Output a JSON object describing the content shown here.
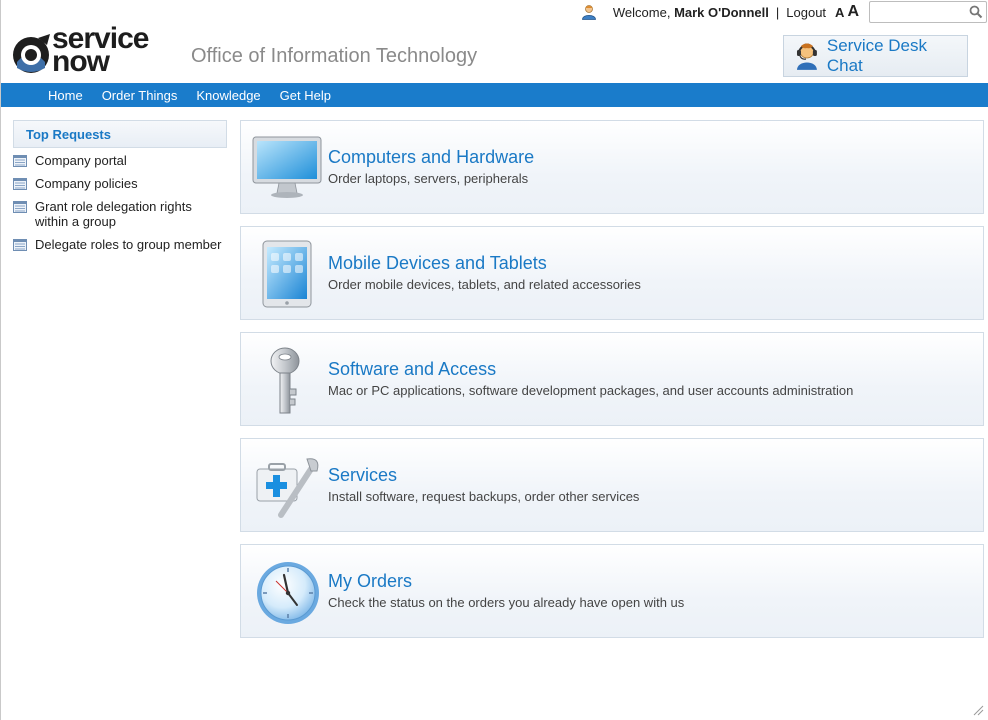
{
  "topbar": {
    "welcome_prefix": "Welcome,",
    "user_name": "Mark O'Donnell",
    "separator": "|",
    "logout_label": "Logout",
    "font_small_label": "A",
    "font_large_label": "A",
    "search_value": ""
  },
  "header": {
    "logo_line1": "service",
    "logo_line2": "now",
    "org_title": "Office of Information Technology",
    "chat_button_label": "Service Desk Chat"
  },
  "nav": {
    "items": [
      "Home",
      "Order Things",
      "Knowledge",
      "Get Help"
    ]
  },
  "sidebar": {
    "header": "Top Requests",
    "items": [
      {
        "label": "Company portal"
      },
      {
        "label": "Company policies"
      },
      {
        "label": "Grant role delegation rights within a group"
      },
      {
        "label": "Delegate roles to group member"
      }
    ]
  },
  "categories": [
    {
      "title": "Computers and Hardware",
      "description": "Order laptops, servers, peripherals",
      "icon": "monitor-icon"
    },
    {
      "title": "Mobile Devices and Tablets",
      "description": "Order mobile devices, tablets, and related accessories",
      "icon": "tablet-icon"
    },
    {
      "title": "Software and Access",
      "description": "Mac or PC applications, software development packages, and user accounts administration",
      "icon": "key-icon"
    },
    {
      "title": "Services",
      "description": "Install software, request backups, order other services",
      "icon": "toolkit-icon"
    },
    {
      "title": "My Orders",
      "description": "Check the status on the orders you already have open with us",
      "icon": "clock-icon"
    }
  ],
  "colors": {
    "accent": "#1a79c5",
    "nav_background": "#1a7ccb"
  }
}
